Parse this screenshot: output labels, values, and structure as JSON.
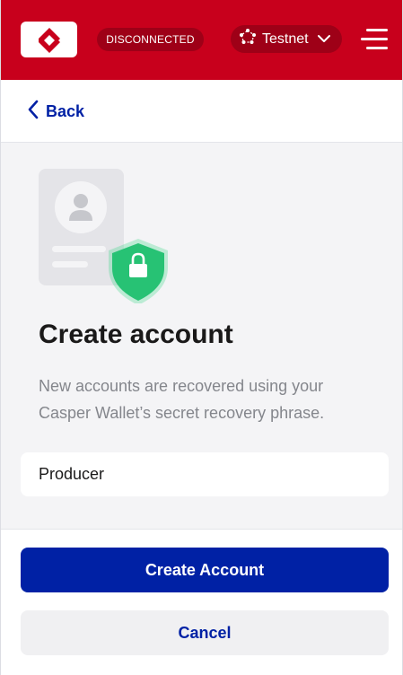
{
  "header": {
    "connection_status": "DISCONNECTED",
    "network_label": "Testnet",
    "brand_color": "#c8001c"
  },
  "nav": {
    "back_label": "Back"
  },
  "main": {
    "title": "Create account",
    "description": "New accounts are recovered using your Casper Wallet’s secret recovery phrase.",
    "account_name_value": "Producer"
  },
  "footer": {
    "primary_label": "Create Account",
    "secondary_label": "Cancel",
    "accent_color": "#0021a5"
  },
  "icons": [
    "casper-logo-icon",
    "network-icon",
    "chevron-down-icon",
    "menu-icon",
    "chevron-left-icon",
    "account-shield-illustration"
  ]
}
